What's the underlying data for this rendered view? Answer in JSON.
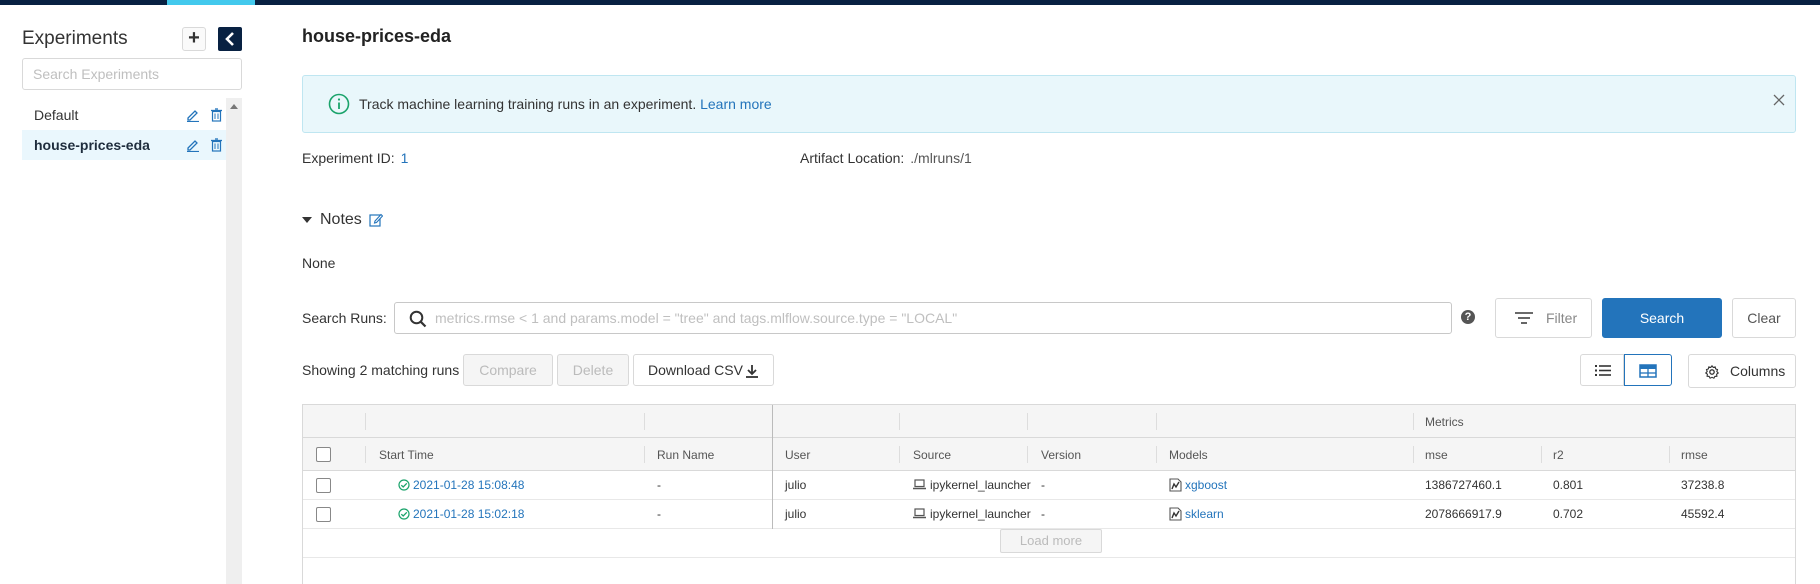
{
  "sidebar": {
    "title": "Experiments",
    "add_label": "+",
    "search_placeholder": "Search Experiments",
    "items": [
      {
        "label": "Default",
        "active": false
      },
      {
        "label": "house-prices-eda",
        "active": true
      }
    ]
  },
  "main": {
    "title": "house-prices-eda",
    "banner": {
      "text": "Track machine learning training runs in an experiment.",
      "link": "Learn more"
    },
    "experiment_id_label": "Experiment ID:",
    "experiment_id": "1",
    "artifact_label": "Artifact Location:",
    "artifact_location": "./mlruns/1",
    "notes_label": "Notes",
    "notes_value": "None",
    "search_label": "Search Runs:",
    "search_placeholder": "metrics.rmse < 1 and params.model = \"tree\" and tags.mlflow.source.type = \"LOCAL\"",
    "help_label": "?",
    "filter_label": "Filter",
    "search_button": "Search",
    "clear_button": "Clear",
    "showing_text": "Showing 2 matching runs",
    "compare_label": "Compare",
    "delete_label": "Delete",
    "download_label": "Download CSV",
    "columns_label": "Columns",
    "load_more": "Load more"
  },
  "table": {
    "group_header": "Metrics",
    "headers": {
      "start_time": "Start Time",
      "run_name": "Run Name",
      "user": "User",
      "source": "Source",
      "version": "Version",
      "models": "Models",
      "mse": "mse",
      "r2": "r2",
      "rmse": "rmse"
    },
    "rows": [
      {
        "start_time": "2021-01-28 15:08:48",
        "run_name": "-",
        "user": "julio",
        "source": "ipykernel_launcher",
        "version": "-",
        "model": "xgboost",
        "mse": "1386727460.1",
        "r2": "0.801",
        "rmse": "37238.8"
      },
      {
        "start_time": "2021-01-28 15:02:18",
        "run_name": "-",
        "user": "julio",
        "source": "ipykernel_launcher",
        "version": "-",
        "model": "sklearn",
        "mse": "2078666917.9",
        "r2": "0.702",
        "rmse": "45592.4"
      }
    ]
  },
  "colors": {
    "accent": "#2374bb",
    "navbar": "#082142",
    "success": "#1aa36b"
  }
}
